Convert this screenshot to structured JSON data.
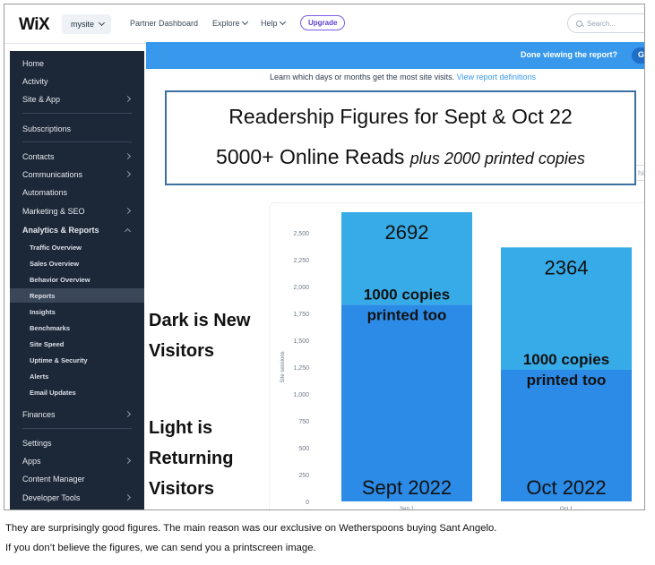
{
  "topbar": {
    "logo": "WiX",
    "site_name": "mysite",
    "nav": [
      "Partner Dashboard",
      "Explore",
      "Help"
    ],
    "upgrade_label": "Upgrade",
    "search_placeholder": "Search..."
  },
  "sidebar": {
    "items": [
      {
        "label": "Home"
      },
      {
        "label": "Activity"
      },
      {
        "label": "Site & App"
      },
      {
        "label": "Subscriptions"
      },
      {
        "label": "Contacts"
      },
      {
        "label": "Communications"
      },
      {
        "label": "Automations"
      },
      {
        "label": "Marketing & SEO"
      },
      {
        "label": "Analytics & Reports"
      },
      {
        "label": "Finances"
      },
      {
        "label": "Settings"
      },
      {
        "label": "Apps"
      },
      {
        "label": "Content Manager"
      },
      {
        "label": "Developer Tools"
      }
    ],
    "sub_items": [
      "Traffic Overview",
      "Sales Overview",
      "Behavior Overview",
      "Reports",
      "Insights",
      "Benchmarks",
      "Site Speed",
      "Uptime & Security",
      "Alerts",
      "Email Updates"
    ]
  },
  "banner": {
    "text": "Done viewing the report?",
    "button": "G"
  },
  "report": {
    "description": "Learn which days or months get the most site visits.",
    "link": "View report definitions"
  },
  "overlay": {
    "line1": "Readership Figures for Sept & Oct 22",
    "line2_main": "5000+ Online Reads",
    "line2_italic": "plus 2000 printed copies",
    "peek": "hir"
  },
  "annotations": {
    "dark": [
      "Dark is New",
      "Visitors"
    ],
    "light": [
      "Light is",
      "Returning",
      "Visitors"
    ]
  },
  "caption": {
    "line1": "They are surprisingly good figures. The main reason was our exclusive on Wetherspoons buying Sant Angelo.",
    "line2": "If you don’t believe the figures, we can send you a printscreen image."
  },
  "chart_data": {
    "type": "bar",
    "stacked": true,
    "ylabel": "Site sessions",
    "ylim": [
      0,
      2500
    ],
    "yticks": [
      0,
      250,
      500,
      750,
      1000,
      1250,
      1500,
      1750,
      2000,
      2250,
      2500
    ],
    "categories": [
      "Sep 1",
      "Oct 1"
    ],
    "series": [
      {
        "values": [
          1830,
          1225
        ],
        "color": "#2b8be6"
      },
      {
        "values": [
          862,
          1139
        ],
        "color": "#37abe8"
      }
    ],
    "totals_labels": [
      "2692",
      "2364"
    ],
    "bar_notes": [
      "1000 copies",
      "printed too"
    ],
    "month_labels": [
      "Sept 2022",
      "Oct 2022"
    ]
  }
}
